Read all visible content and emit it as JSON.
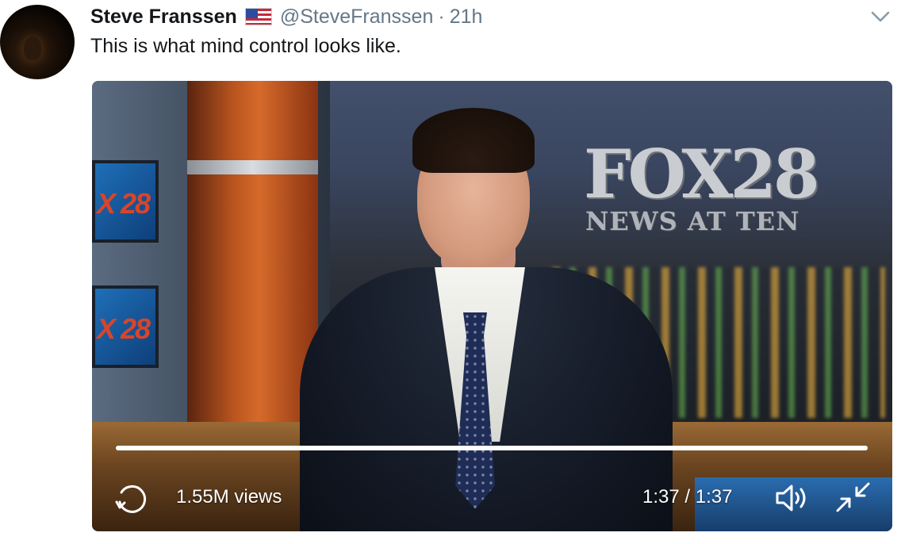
{
  "tweet": {
    "author_name": "Steve Franssen",
    "flag_icon": "us-flag-icon",
    "handle": "@SteveFranssen",
    "separator": "·",
    "time": "21h",
    "text": "This is what mind control looks like."
  },
  "video": {
    "overlay_logo": "FOX28",
    "overlay_subtitle": "NEWS AT TEN",
    "monitor_label_1": "X 28",
    "monitor_label_2": "X 28",
    "progress_fraction": 1.0,
    "views": "1.55M views",
    "timecode": "1:37 / 1:37",
    "icons": {
      "replay": "replay-icon",
      "volume": "volume-icon",
      "minimize": "minimize-icon",
      "menu": "chevron-down-icon"
    }
  },
  "colors": {
    "name": "#14171a",
    "meta": "#657786",
    "video_text": "#ffffff"
  }
}
